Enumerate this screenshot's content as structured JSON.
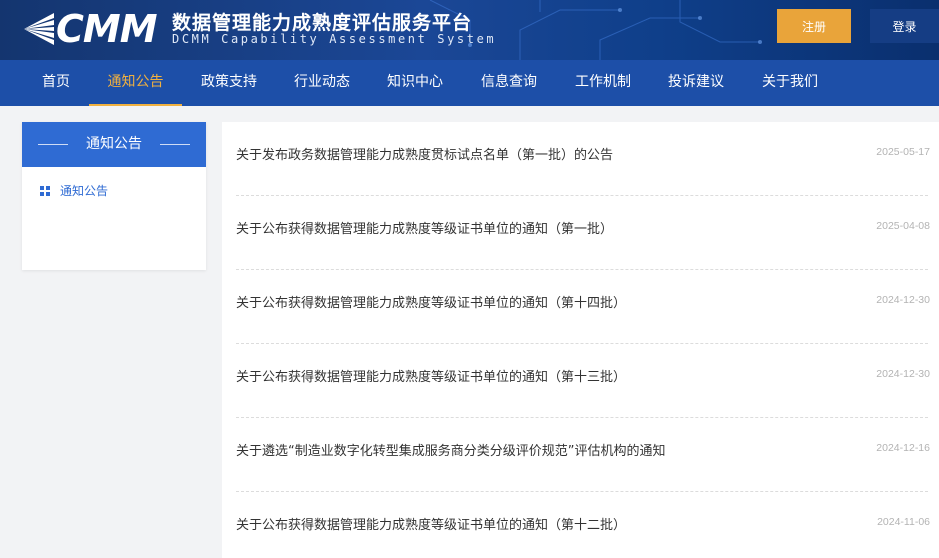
{
  "header": {
    "logo_text": "CMM",
    "title": "数据管理能力成熟度评估服务平台",
    "subtitle": "DCMM Capability Assessment System",
    "register_label": "注册",
    "login_label": "登录",
    "colors": {
      "register": "#e9a43a",
      "login": "#153d84",
      "nav": "#1d4fa8",
      "accent": "#f0b040"
    }
  },
  "nav": {
    "items": [
      {
        "label": "首页"
      },
      {
        "label": "通知公告",
        "active": true
      },
      {
        "label": "政策支持"
      },
      {
        "label": "行业动态"
      },
      {
        "label": "知识中心"
      },
      {
        "label": "信息查询"
      },
      {
        "label": "工作机制"
      },
      {
        "label": "投诉建议"
      },
      {
        "label": "关于我们"
      }
    ]
  },
  "sidebar": {
    "heading": "通知公告",
    "items": [
      {
        "label": "通知公告",
        "icon": "grid-icon"
      }
    ]
  },
  "notices": [
    {
      "title": "关于发布政务数据管理能力成熟度贯标试点名单（第一批）的公告",
      "date": "2025-05-17"
    },
    {
      "title": "关于公布获得数据管理能力成熟度等级证书单位的通知（第一批）",
      "date": "2025-04-08"
    },
    {
      "title": "关于公布获得数据管理能力成熟度等级证书单位的通知（第十四批）",
      "date": "2024-12-30"
    },
    {
      "title": "关于公布获得数据管理能力成熟度等级证书单位的通知（第十三批）",
      "date": "2024-12-30"
    },
    {
      "title": "关于遴选“制造业数字化转型集成服务商分类分级评价规范”评估机构的通知",
      "date": "2024-12-16"
    },
    {
      "title": "关于公布获得数据管理能力成熟度等级证书单位的通知（第十二批）",
      "date": "2024-11-06"
    }
  ]
}
